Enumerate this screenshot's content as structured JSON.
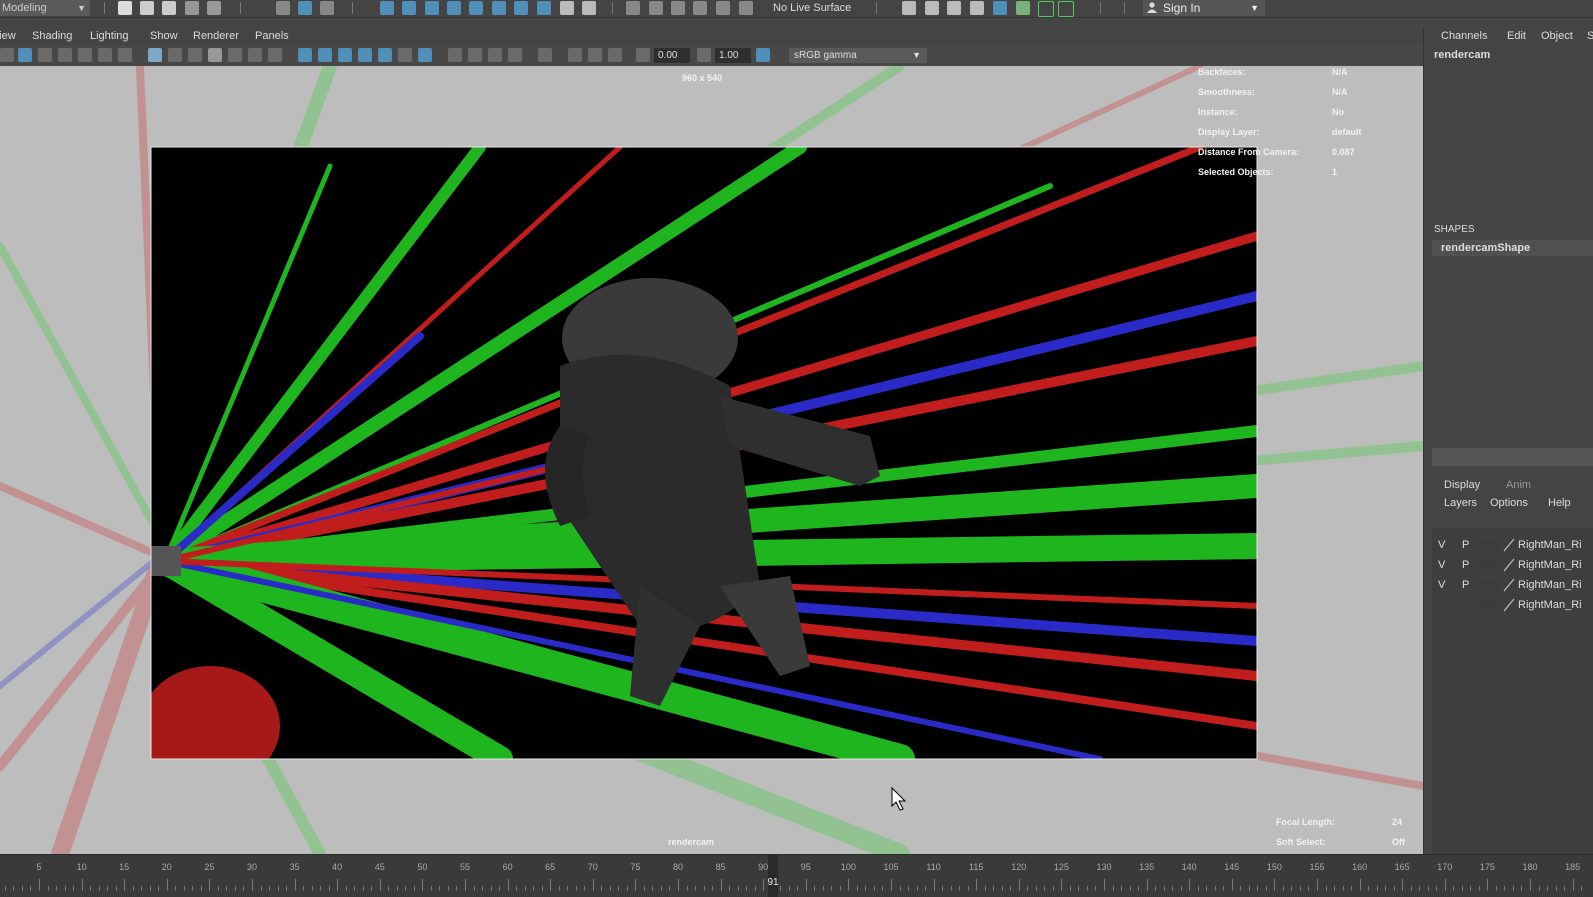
{
  "status_line": {
    "mode": "Modeling",
    "live_surface": "No Live Surface",
    "sign_in": "Sign In"
  },
  "panel_menu": [
    "View",
    "Shading",
    "Lighting",
    "Show",
    "Renderer",
    "Panels"
  ],
  "panel_toolbar": {
    "exposure": "0.00",
    "gamma": "1.00",
    "color_space": "sRGB gamma"
  },
  "viewport": {
    "resolution": "960 x 540",
    "camera_name": "rendercam",
    "hud_left": [
      "Backfaces:",
      "Smoothness:",
      "Instance:",
      "Display Layer:",
      "Distance From Camera:",
      "Selected Objects:"
    ],
    "hud_right": [
      "N/A",
      "N/A",
      "No",
      "default",
      "0.087",
      "1"
    ],
    "focal_length_label": "Focal Length:",
    "focal_length_value": "24",
    "soft_select_label": "Soft Select:",
    "soft_select_value": "Off"
  },
  "channel_box": {
    "menu": [
      "Channels",
      "Edit",
      "Object",
      "S"
    ],
    "node": "rendercam",
    "shapes_header": "SHAPES",
    "shape_node": "rendercamShape"
  },
  "layer_editor": {
    "tabs": [
      "Display",
      "Anim"
    ],
    "menu": [
      "Layers",
      "Options",
      "Help"
    ],
    "rows": [
      {
        "v": "V",
        "p": "P",
        "name": "RightMan_Ri"
      },
      {
        "v": "V",
        "p": "P",
        "name": "RightMan_Ri"
      },
      {
        "v": "V",
        "p": "P",
        "name": "RightMan_Ri"
      },
      {
        "v": "",
        "p": "",
        "name": "RightMan_Ri"
      }
    ]
  },
  "timeline": {
    "labels": [
      "5",
      "10",
      "15",
      "20",
      "25",
      "30",
      "35",
      "40",
      "45",
      "50",
      "55",
      "60",
      "65",
      "70",
      "75",
      "80",
      "85",
      "90",
      "95",
      "100",
      "105",
      "110",
      "115",
      "120",
      "125",
      "130",
      "135",
      "140",
      "145",
      "150",
      "155",
      "160",
      "165",
      "170",
      "175",
      "180",
      "185"
    ],
    "current_frame": "91"
  },
  "colors": {
    "ui_bg": "#444444",
    "viewport_bg": "#bdbdbd",
    "accent_blue": "#4f8fb8"
  }
}
